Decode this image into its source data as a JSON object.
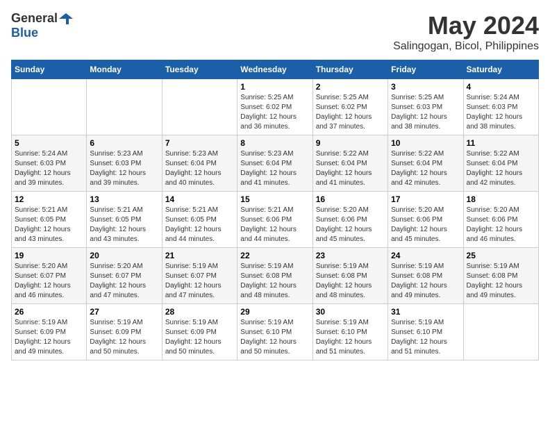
{
  "logo": {
    "general": "General",
    "blue": "Blue"
  },
  "title": {
    "month_year": "May 2024",
    "location": "Salingogan, Bicol, Philippines"
  },
  "days_of_week": [
    "Sunday",
    "Monday",
    "Tuesday",
    "Wednesday",
    "Thursday",
    "Friday",
    "Saturday"
  ],
  "weeks": [
    [
      {
        "day": "",
        "sunrise": "",
        "sunset": "",
        "daylight": ""
      },
      {
        "day": "",
        "sunrise": "",
        "sunset": "",
        "daylight": ""
      },
      {
        "day": "",
        "sunrise": "",
        "sunset": "",
        "daylight": ""
      },
      {
        "day": "1",
        "sunrise": "Sunrise: 5:25 AM",
        "sunset": "Sunset: 6:02 PM",
        "daylight": "Daylight: 12 hours and 36 minutes."
      },
      {
        "day": "2",
        "sunrise": "Sunrise: 5:25 AM",
        "sunset": "Sunset: 6:02 PM",
        "daylight": "Daylight: 12 hours and 37 minutes."
      },
      {
        "day": "3",
        "sunrise": "Sunrise: 5:25 AM",
        "sunset": "Sunset: 6:03 PM",
        "daylight": "Daylight: 12 hours and 38 minutes."
      },
      {
        "day": "4",
        "sunrise": "Sunrise: 5:24 AM",
        "sunset": "Sunset: 6:03 PM",
        "daylight": "Daylight: 12 hours and 38 minutes."
      }
    ],
    [
      {
        "day": "5",
        "sunrise": "Sunrise: 5:24 AM",
        "sunset": "Sunset: 6:03 PM",
        "daylight": "Daylight: 12 hours and 39 minutes."
      },
      {
        "day": "6",
        "sunrise": "Sunrise: 5:23 AM",
        "sunset": "Sunset: 6:03 PM",
        "daylight": "Daylight: 12 hours and 39 minutes."
      },
      {
        "day": "7",
        "sunrise": "Sunrise: 5:23 AM",
        "sunset": "Sunset: 6:04 PM",
        "daylight": "Daylight: 12 hours and 40 minutes."
      },
      {
        "day": "8",
        "sunrise": "Sunrise: 5:23 AM",
        "sunset": "Sunset: 6:04 PM",
        "daylight": "Daylight: 12 hours and 41 minutes."
      },
      {
        "day": "9",
        "sunrise": "Sunrise: 5:22 AM",
        "sunset": "Sunset: 6:04 PM",
        "daylight": "Daylight: 12 hours and 41 minutes."
      },
      {
        "day": "10",
        "sunrise": "Sunrise: 5:22 AM",
        "sunset": "Sunset: 6:04 PM",
        "daylight": "Daylight: 12 hours and 42 minutes."
      },
      {
        "day": "11",
        "sunrise": "Sunrise: 5:22 AM",
        "sunset": "Sunset: 6:04 PM",
        "daylight": "Daylight: 12 hours and 42 minutes."
      }
    ],
    [
      {
        "day": "12",
        "sunrise": "Sunrise: 5:21 AM",
        "sunset": "Sunset: 6:05 PM",
        "daylight": "Daylight: 12 hours and 43 minutes."
      },
      {
        "day": "13",
        "sunrise": "Sunrise: 5:21 AM",
        "sunset": "Sunset: 6:05 PM",
        "daylight": "Daylight: 12 hours and 43 minutes."
      },
      {
        "day": "14",
        "sunrise": "Sunrise: 5:21 AM",
        "sunset": "Sunset: 6:05 PM",
        "daylight": "Daylight: 12 hours and 44 minutes."
      },
      {
        "day": "15",
        "sunrise": "Sunrise: 5:21 AM",
        "sunset": "Sunset: 6:06 PM",
        "daylight": "Daylight: 12 hours and 44 minutes."
      },
      {
        "day": "16",
        "sunrise": "Sunrise: 5:20 AM",
        "sunset": "Sunset: 6:06 PM",
        "daylight": "Daylight: 12 hours and 45 minutes."
      },
      {
        "day": "17",
        "sunrise": "Sunrise: 5:20 AM",
        "sunset": "Sunset: 6:06 PM",
        "daylight": "Daylight: 12 hours and 45 minutes."
      },
      {
        "day": "18",
        "sunrise": "Sunrise: 5:20 AM",
        "sunset": "Sunset: 6:06 PM",
        "daylight": "Daylight: 12 hours and 46 minutes."
      }
    ],
    [
      {
        "day": "19",
        "sunrise": "Sunrise: 5:20 AM",
        "sunset": "Sunset: 6:07 PM",
        "daylight": "Daylight: 12 hours and 46 minutes."
      },
      {
        "day": "20",
        "sunrise": "Sunrise: 5:20 AM",
        "sunset": "Sunset: 6:07 PM",
        "daylight": "Daylight: 12 hours and 47 minutes."
      },
      {
        "day": "21",
        "sunrise": "Sunrise: 5:19 AM",
        "sunset": "Sunset: 6:07 PM",
        "daylight": "Daylight: 12 hours and 47 minutes."
      },
      {
        "day": "22",
        "sunrise": "Sunrise: 5:19 AM",
        "sunset": "Sunset: 6:08 PM",
        "daylight": "Daylight: 12 hours and 48 minutes."
      },
      {
        "day": "23",
        "sunrise": "Sunrise: 5:19 AM",
        "sunset": "Sunset: 6:08 PM",
        "daylight": "Daylight: 12 hours and 48 minutes."
      },
      {
        "day": "24",
        "sunrise": "Sunrise: 5:19 AM",
        "sunset": "Sunset: 6:08 PM",
        "daylight": "Daylight: 12 hours and 49 minutes."
      },
      {
        "day": "25",
        "sunrise": "Sunrise: 5:19 AM",
        "sunset": "Sunset: 6:08 PM",
        "daylight": "Daylight: 12 hours and 49 minutes."
      }
    ],
    [
      {
        "day": "26",
        "sunrise": "Sunrise: 5:19 AM",
        "sunset": "Sunset: 6:09 PM",
        "daylight": "Daylight: 12 hours and 49 minutes."
      },
      {
        "day": "27",
        "sunrise": "Sunrise: 5:19 AM",
        "sunset": "Sunset: 6:09 PM",
        "daylight": "Daylight: 12 hours and 50 minutes."
      },
      {
        "day": "28",
        "sunrise": "Sunrise: 5:19 AM",
        "sunset": "Sunset: 6:09 PM",
        "daylight": "Daylight: 12 hours and 50 minutes."
      },
      {
        "day": "29",
        "sunrise": "Sunrise: 5:19 AM",
        "sunset": "Sunset: 6:10 PM",
        "daylight": "Daylight: 12 hours and 50 minutes."
      },
      {
        "day": "30",
        "sunrise": "Sunrise: 5:19 AM",
        "sunset": "Sunset: 6:10 PM",
        "daylight": "Daylight: 12 hours and 51 minutes."
      },
      {
        "day": "31",
        "sunrise": "Sunrise: 5:19 AM",
        "sunset": "Sunset: 6:10 PM",
        "daylight": "Daylight: 12 hours and 51 minutes."
      },
      {
        "day": "",
        "sunrise": "",
        "sunset": "",
        "daylight": ""
      }
    ]
  ]
}
